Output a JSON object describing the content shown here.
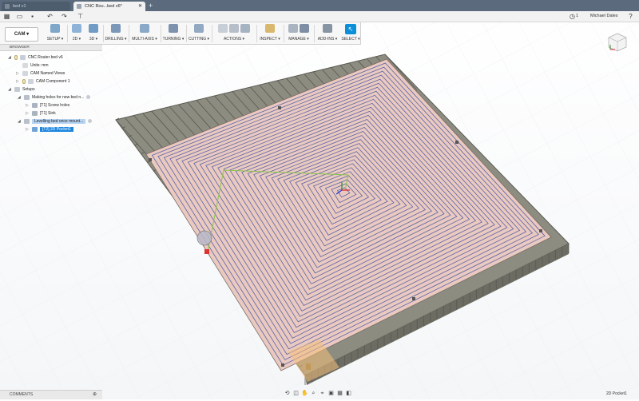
{
  "tabs": [
    {
      "label": "bed v1",
      "active": false
    },
    {
      "label": "CNC Rou...bed v6*",
      "active": true
    }
  ],
  "quickbar": {
    "job_count": "1",
    "user_name": "Michael Dales"
  },
  "toolbar": {
    "workspace": "CAM",
    "groups": [
      {
        "label": "SETUP ▾"
      },
      {
        "label": "2D ▾"
      },
      {
        "label": "3D ▾"
      },
      {
        "label": "DRILLING ▾"
      },
      {
        "label": "MULTI-AXIS ▾"
      },
      {
        "label": "TURNING ▾"
      },
      {
        "label": "CUTTING ▾"
      },
      {
        "label": "ACTIONS ▾"
      },
      {
        "label": "INSPECT ▾"
      },
      {
        "label": "MANAGE ▾"
      },
      {
        "label": "ADD-INS ▾"
      },
      {
        "label": "SELECT ▾"
      }
    ]
  },
  "browser": {
    "title": "BROWSER",
    "items": [
      {
        "label": "CNC Router bed v6"
      },
      {
        "label": "Units: mm"
      },
      {
        "label": "CAM Named Views"
      },
      {
        "label": "CAM Component 1"
      },
      {
        "label": "Setups"
      },
      {
        "label": "Making holes for new bed n..."
      },
      {
        "label": "[T1] Screw holes"
      },
      {
        "label": "[T1] Sink"
      },
      {
        "label": "Levelling bed once mount..."
      },
      {
        "label": "[T2] 2D Pocket1"
      }
    ]
  },
  "comments": {
    "title": "COMMENTS"
  },
  "status": {
    "active_operation": "2D Pocket1"
  },
  "icons": {
    "grid": "grid-icon",
    "file": "file-icon",
    "save": "save-icon",
    "undo": "undo-icon",
    "redo": "redo-icon",
    "clock": "clock-icon",
    "help": "help-icon",
    "viewcube": "viewcube-icon"
  },
  "colors": {
    "accent": "#0a8fd8",
    "stock_top": "#e8c7bd",
    "toolpath": "#5a63a8",
    "lead": "#8bc34a",
    "rails": "#7f7f73"
  }
}
